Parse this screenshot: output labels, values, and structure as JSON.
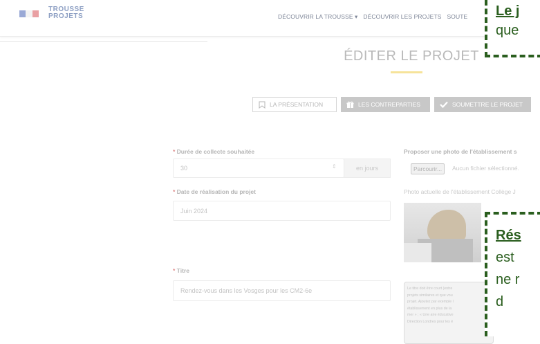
{
  "header": {
    "logo_line1": "TROUSSE",
    "logo_line2": "PROJETS",
    "nav": [
      {
        "label": "DÉCOUVRIR LA TROUSSE ▾"
      },
      {
        "label": "DÉCOUVRIR LES PROJETS"
      },
      {
        "label": "SOUTE"
      }
    ]
  },
  "page": {
    "title": "ÉDITER LE PROJET",
    "tabs": [
      {
        "label": "LA PRÉSENTATION"
      },
      {
        "label": "LES CONTREPARTIES"
      },
      {
        "label": "SOUMETTRE LE PROJET"
      }
    ]
  },
  "form": {
    "duree": {
      "label": "Durée de collecte souhaitée",
      "value": "30",
      "unit": "en jours"
    },
    "date": {
      "label": "Date de réalisation du projet",
      "value": "Juin 2024"
    },
    "titre": {
      "label": "Titre",
      "value": "Rendez-vous dans les Vosges pour les CM2-6e"
    },
    "photo": {
      "label": "Proposer une photo de l'établissement s",
      "browse_label": "Parcourir...",
      "no_file": "Aucun fichier sélectionné.",
      "current": "Photo actuelle de l'établissement Collège J"
    },
    "help_lines": [
      "Le titre doit être court (entre",
      "projets similaires et que vou",
      "projet. Ajoutez par exemple l",
      "établissement en plus de la",
      "mer » ; « Une aire éducative",
      "Direction Londres pour les é"
    ]
  },
  "callouts": [
    {
      "head": "Le j",
      "lines": [
        "que"
      ]
    },
    {
      "head": "Rés",
      "lines": [
        "est",
        "ne r",
        "d"
      ]
    }
  ],
  "colors": {
    "accent_underline": "#f6e39a",
    "callout_border": "#2a5e1e",
    "tab_filled": "#c8c8c8"
  }
}
